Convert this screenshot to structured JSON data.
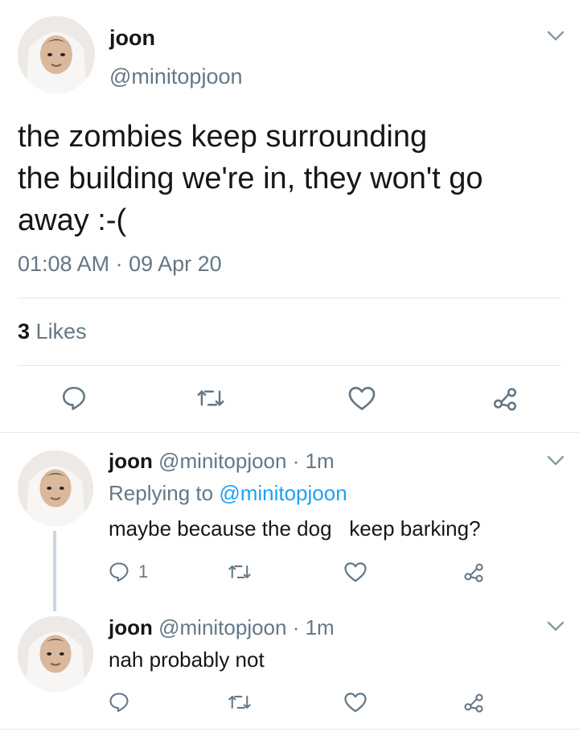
{
  "main_tweet": {
    "display_name": "joon",
    "handle": "@minitopjoon",
    "text_lines": [
      "the zombies keep surrounding",
      "the building we're in, they won't go",
      "away :-("
    ],
    "timestamp": "01:08 AM · 09 Apr 20",
    "likes_count": "3",
    "likes_label": "Likes"
  },
  "replies": [
    {
      "display_name": "joon",
      "handle": "@minitopjoon",
      "time": "· 1m",
      "replying_prefix": "Replying to",
      "replying_to": "@minitopjoon",
      "text": "maybe because the dog   keep barking?",
      "reply_count": "1"
    },
    {
      "display_name": "joon",
      "handle": "@minitopjoon",
      "time": "· 1m",
      "text": "nah probably not"
    }
  ],
  "icons": [
    "reply-icon",
    "retweet-icon",
    "like-icon",
    "share-icon",
    "chevron-down-icon"
  ],
  "colors": {
    "text": "#14171a",
    "muted": "#657786",
    "link": "#1da1f2",
    "divider": "#e1e8ed"
  }
}
